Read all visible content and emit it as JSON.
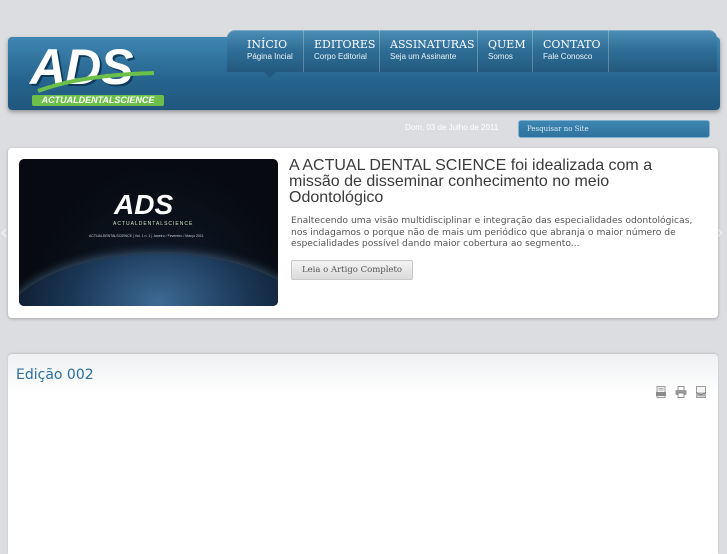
{
  "logo": {
    "main": "ADS",
    "sub": "ACTUALDENTALSCIENCE"
  },
  "nav": [
    {
      "title": "INÍCIO",
      "sub": "Página Incial"
    },
    {
      "title": "EDITORES",
      "sub": "Corpo Editorial"
    },
    {
      "title": "ASSINATURAS",
      "sub": "Seja um Assinante"
    },
    {
      "title": "QUEM",
      "sub": "Somos"
    },
    {
      "title": "CONTATO",
      "sub": "Fale Conosco"
    }
  ],
  "header": {
    "date": "Dom, 03 de Julho de 2011"
  },
  "search": {
    "placeholder": "Pesquisar no Site"
  },
  "feature": {
    "image": {
      "logo": "ADS",
      "sub": "ACTUALDENTALSCIENCE",
      "line": "ACTUALDENTALSCIENCE | Vol. 1 n. 1 | Janeiro / Fevereiro / Março 2011"
    },
    "title": "A ACTUAL DENTAL SCIENCE foi idealizada com a missão de disseminar conhecimento no meio Odontológico",
    "text": "Enaltecendo uma visão multidisciplinar e integração das especialidades odontológicas, nos indagamos o porque não de mais um periódico que abranja o maior número de especialidades possível dando maior cobertura ao segmento...",
    "button": "Leia o Artigo Completo",
    "arrow_left": "‹",
    "arrow_right": "›"
  },
  "edition": {
    "title": "Edição 002"
  },
  "icons": [
    "pdf-icon",
    "print-icon",
    "email-icon"
  ],
  "colors": {
    "header": "#27668f",
    "accent": "#2a6e9c",
    "logo_green": "#6cc04a"
  }
}
